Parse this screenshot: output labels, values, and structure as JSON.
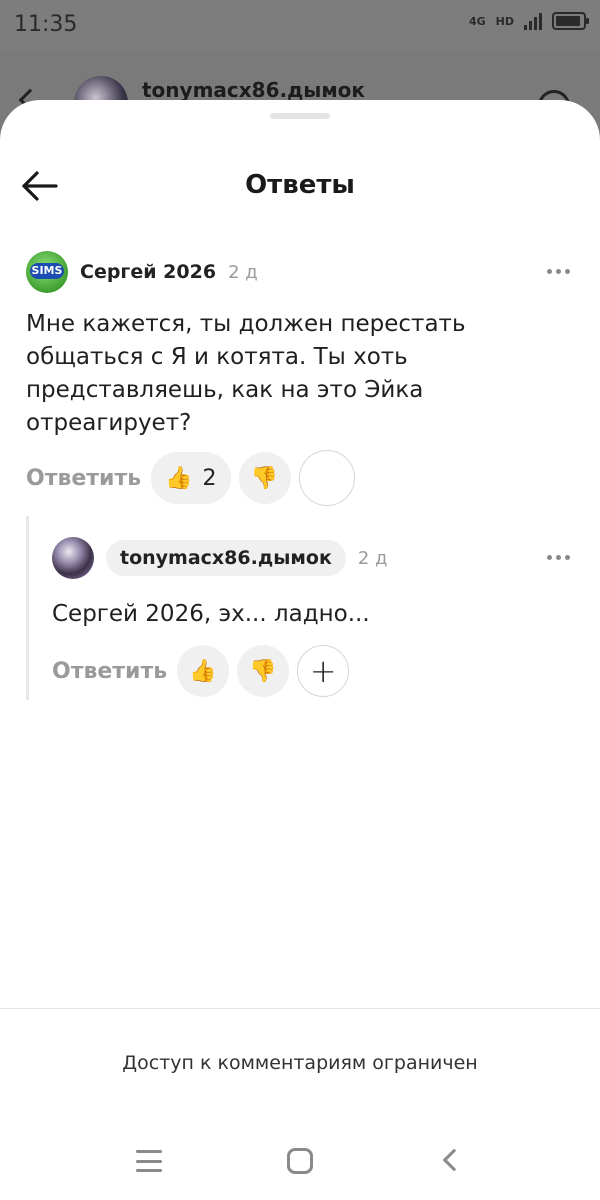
{
  "status_bar": {
    "time": "11:35",
    "network": "4G",
    "network_sub": "HD"
  },
  "background_app": {
    "username": "tonymacx86.дымок"
  },
  "sheet": {
    "title": "Ответы"
  },
  "comment": {
    "author": "Сергей 2026",
    "time": "2 д",
    "text": "Мне кажется, ты должен перестать общаться с Я и котята. Ты хоть представляешь, как на это Эйка отреагирует?",
    "reply_label": "Ответить",
    "like_emoji": "👍",
    "like_count": "2",
    "dislike_emoji": "👎"
  },
  "reply": {
    "author": "tonymacx86.дымок",
    "time": "2 д",
    "text": "Сергей 2026, эх... ладно...",
    "reply_label": "Ответить",
    "like_emoji": "👍",
    "dislike_emoji": "👎",
    "add_symbol": "+"
  },
  "footer": {
    "restricted_text": "Доступ к комментариям ограничен"
  },
  "avatars": {
    "sims_logo": "SIMS"
  }
}
